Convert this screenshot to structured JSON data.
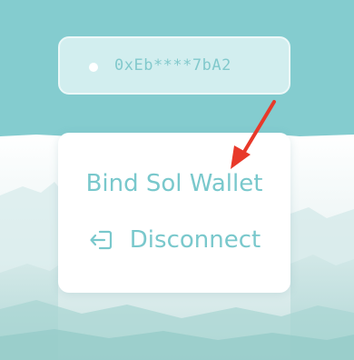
{
  "wallet": {
    "address": "0xEb****7bA2",
    "status_icon": "status-dot-icon"
  },
  "menu": {
    "items": [
      {
        "label": "Bind Sol Wallet",
        "icon": ""
      },
      {
        "label": "Disconnect",
        "icon": "logout-icon"
      }
    ]
  },
  "colors": {
    "background_teal": "#84cccf",
    "pill_bg": "#d2eeef",
    "accent_text": "#79c8cc",
    "annotation_arrow": "#e8392a"
  }
}
